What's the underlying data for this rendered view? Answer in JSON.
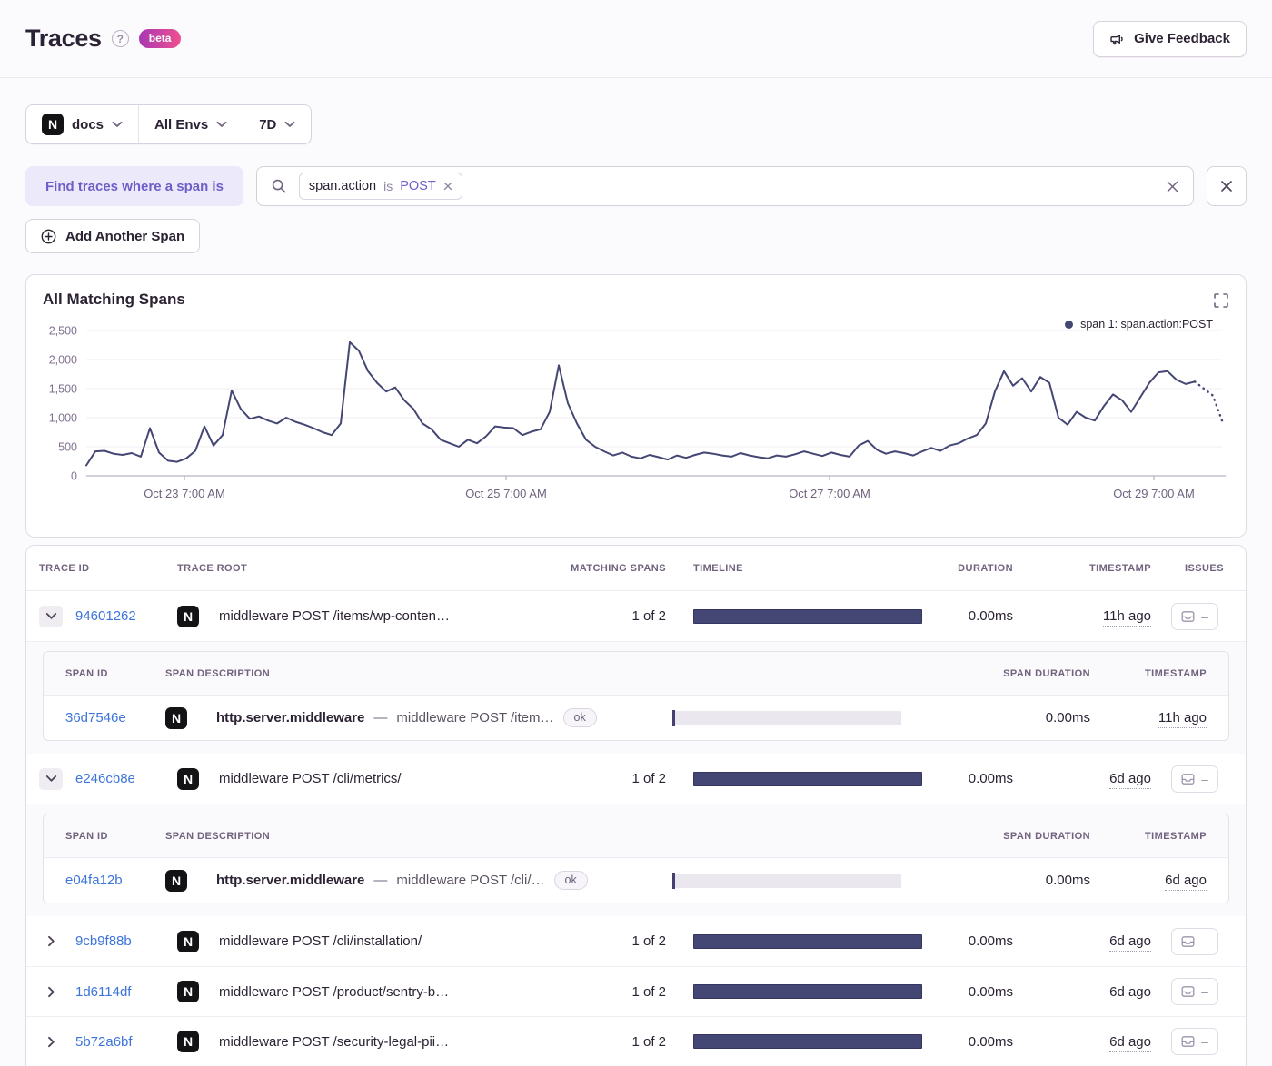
{
  "header": {
    "title": "Traces",
    "beta_label": "beta",
    "feedback_label": "Give Feedback"
  },
  "filters": {
    "project": "docs",
    "environment": "All Envs",
    "period": "7D"
  },
  "span_filter": {
    "label": "Find traces where a span is",
    "token": {
      "key": "span.action",
      "op": "is",
      "value": "POST"
    },
    "add_button_label": "Add Another Span"
  },
  "chart": {
    "title": "All Matching Spans",
    "legend": "span 1: span.action:POST"
  },
  "chart_data": {
    "type": "line",
    "title": "All Matching Spans",
    "ylabel": "",
    "xlabel": "",
    "ylim": [
      0,
      2500
    ],
    "yticks": [
      0,
      500,
      1000,
      1500,
      2000,
      2500
    ],
    "ytick_labels": [
      "0",
      "500",
      "1,000",
      "1,500",
      "2,000",
      "2,500"
    ],
    "xticks": [
      {
        "label": "Oct 23 7:00 AM",
        "frac": 0.0864
      },
      {
        "label": "Oct 25 7:00 AM",
        "frac": 0.3696
      },
      {
        "label": "Oct 27 7:00 AM",
        "frac": 0.6544
      },
      {
        "label": "Oct 29 7:00 AM",
        "frac": 0.94
      }
    ],
    "grid": true,
    "legend_position": "top-right",
    "line_color": "#444674",
    "dashed_tail_points": 4,
    "series": [
      {
        "name": "span 1: span.action:POST",
        "values": [
          180,
          420,
          430,
          380,
          360,
          390,
          330,
          820,
          400,
          260,
          240,
          300,
          430,
          850,
          520,
          700,
          1470,
          1150,
          980,
          1020,
          950,
          900,
          1000,
          930,
          880,
          820,
          750,
          700,
          900,
          2300,
          2150,
          1800,
          1600,
          1450,
          1520,
          1300,
          1150,
          900,
          800,
          620,
          560,
          500,
          620,
          560,
          680,
          850,
          830,
          820,
          700,
          760,
          800,
          1100,
          1900,
          1250,
          900,
          620,
          500,
          420,
          350,
          400,
          330,
          300,
          360,
          320,
          280,
          350,
          310,
          360,
          400,
          380,
          350,
          330,
          390,
          350,
          320,
          300,
          350,
          330,
          370,
          420,
          380,
          340,
          400,
          360,
          330,
          520,
          600,
          450,
          380,
          420,
          390,
          350,
          420,
          480,
          430,
          520,
          560,
          640,
          700,
          900,
          1450,
          1800,
          1550,
          1680,
          1450,
          1700,
          1600,
          1000,
          880,
          1100,
          1000,
          950,
          1200,
          1400,
          1300,
          1100,
          1350,
          1600,
          1780,
          1800,
          1650,
          1580,
          1620,
          1500,
          1380,
          950
        ]
      }
    ]
  },
  "icons": {
    "platform_letter": "N"
  },
  "table": {
    "headers": {
      "trace_id": "TRACE ID",
      "trace_root": "TRACE ROOT",
      "matching_spans": "MATCHING SPANS",
      "timeline": "TIMELINE",
      "duration": "DURATION",
      "timestamp": "TIMESTAMP",
      "issues": "ISSUES"
    },
    "sub_headers": {
      "span_id": "SPAN ID",
      "span_description": "SPAN DESCRIPTION",
      "span_duration": "SPAN DURATION",
      "timestamp": "TIMESTAMP"
    },
    "span_separator": "—",
    "issues_empty": "–",
    "rows": [
      {
        "trace_id": "94601262",
        "trace_root": "middleware POST /items/wp-conten…",
        "matching_spans": "1 of 2",
        "duration": "0.00ms",
        "timestamp": "11h ago",
        "spans": [
          {
            "span_id": "36d7546e",
            "op": "http.server.middleware",
            "description": "middleware POST /item…",
            "status": "ok",
            "span_duration": "0.00ms",
            "timestamp": "11h ago"
          }
        ]
      },
      {
        "trace_id": "e246cb8e",
        "trace_root": "middleware POST /cli/metrics/",
        "matching_spans": "1 of 2",
        "duration": "0.00ms",
        "timestamp": "6d ago",
        "spans": [
          {
            "span_id": "e04fa12b",
            "op": "http.server.middleware",
            "description": "middleware POST /cli/…",
            "status": "ok",
            "span_duration": "0.00ms",
            "timestamp": "6d ago"
          }
        ]
      },
      {
        "trace_id": "9cb9f88b",
        "trace_root": "middleware POST /cli/installation/",
        "matching_spans": "1 of 2",
        "duration": "0.00ms",
        "timestamp": "6d ago"
      },
      {
        "trace_id": "1d6114df",
        "trace_root": "middleware POST /product/sentry-b…",
        "matching_spans": "1 of 2",
        "duration": "0.00ms",
        "timestamp": "6d ago"
      },
      {
        "trace_id": "5b72a6bf",
        "trace_root": "middleware POST /security-legal-pii…",
        "matching_spans": "1 of 2",
        "duration": "0.00ms",
        "timestamp": "6d ago"
      }
    ]
  }
}
